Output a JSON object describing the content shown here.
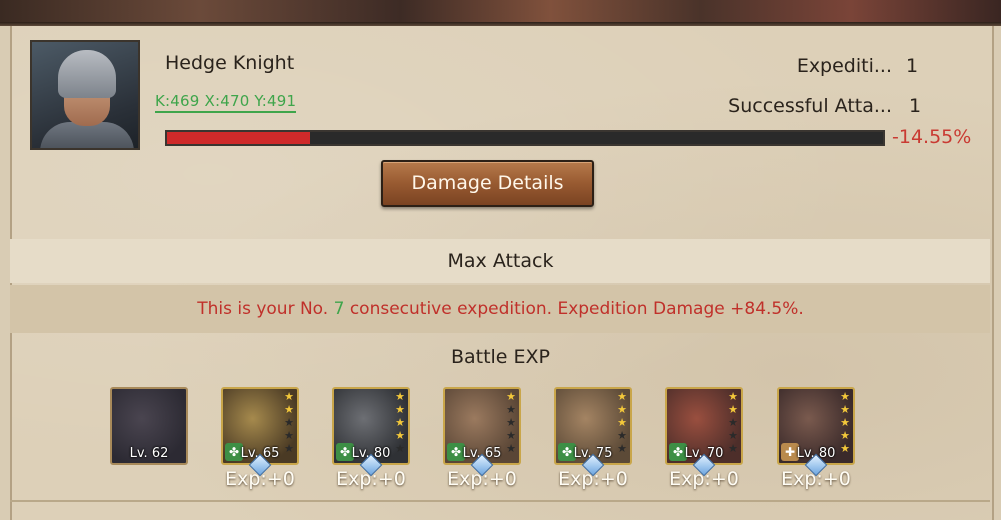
{
  "commander": {
    "name": "Hedge Knight",
    "coords": "K:469 X:470 Y:491",
    "expeditions_label": "Expediti...",
    "expeditions_value": "1",
    "successful_label": "Successful Atta...",
    "successful_value": "1",
    "troop_change": "-14.55%",
    "troop_bar_fraction": 0.2
  },
  "damage_button": "Damage Details",
  "max_attack": "Max Attack",
  "consecutive": {
    "prefix": "This is your No.",
    "number": "7",
    "suffix": "consecutive expedition. Expedition Damage +84.5%."
  },
  "battle_exp_title": "Battle EXP",
  "units": [
    {
      "level": "Lv. 62",
      "type": "dragon",
      "exp": ""
    },
    {
      "level": "Lv. 65",
      "stars": 2,
      "badge": "green",
      "exp": "Exp:+0"
    },
    {
      "level": "Lv. 80",
      "stars": 4,
      "badge": "green",
      "exp": "Exp:+0"
    },
    {
      "level": "Lv. 65",
      "stars": 1,
      "badge": "green",
      "exp": "Exp:+0"
    },
    {
      "level": "Lv. 75",
      "stars": 3,
      "badge": "green",
      "exp": "Exp:+0"
    },
    {
      "level": "Lv. 70",
      "stars": 2,
      "badge": "green",
      "exp": "Exp:+0"
    },
    {
      "level": "Lv. 80",
      "stars": 5,
      "badge": "bronze",
      "exp": "Exp:+0"
    }
  ],
  "colors": {
    "bar_fill": "#cf2a2a",
    "negative": "#c93a32",
    "positive": "#3fa54b",
    "button": "#985a31"
  }
}
